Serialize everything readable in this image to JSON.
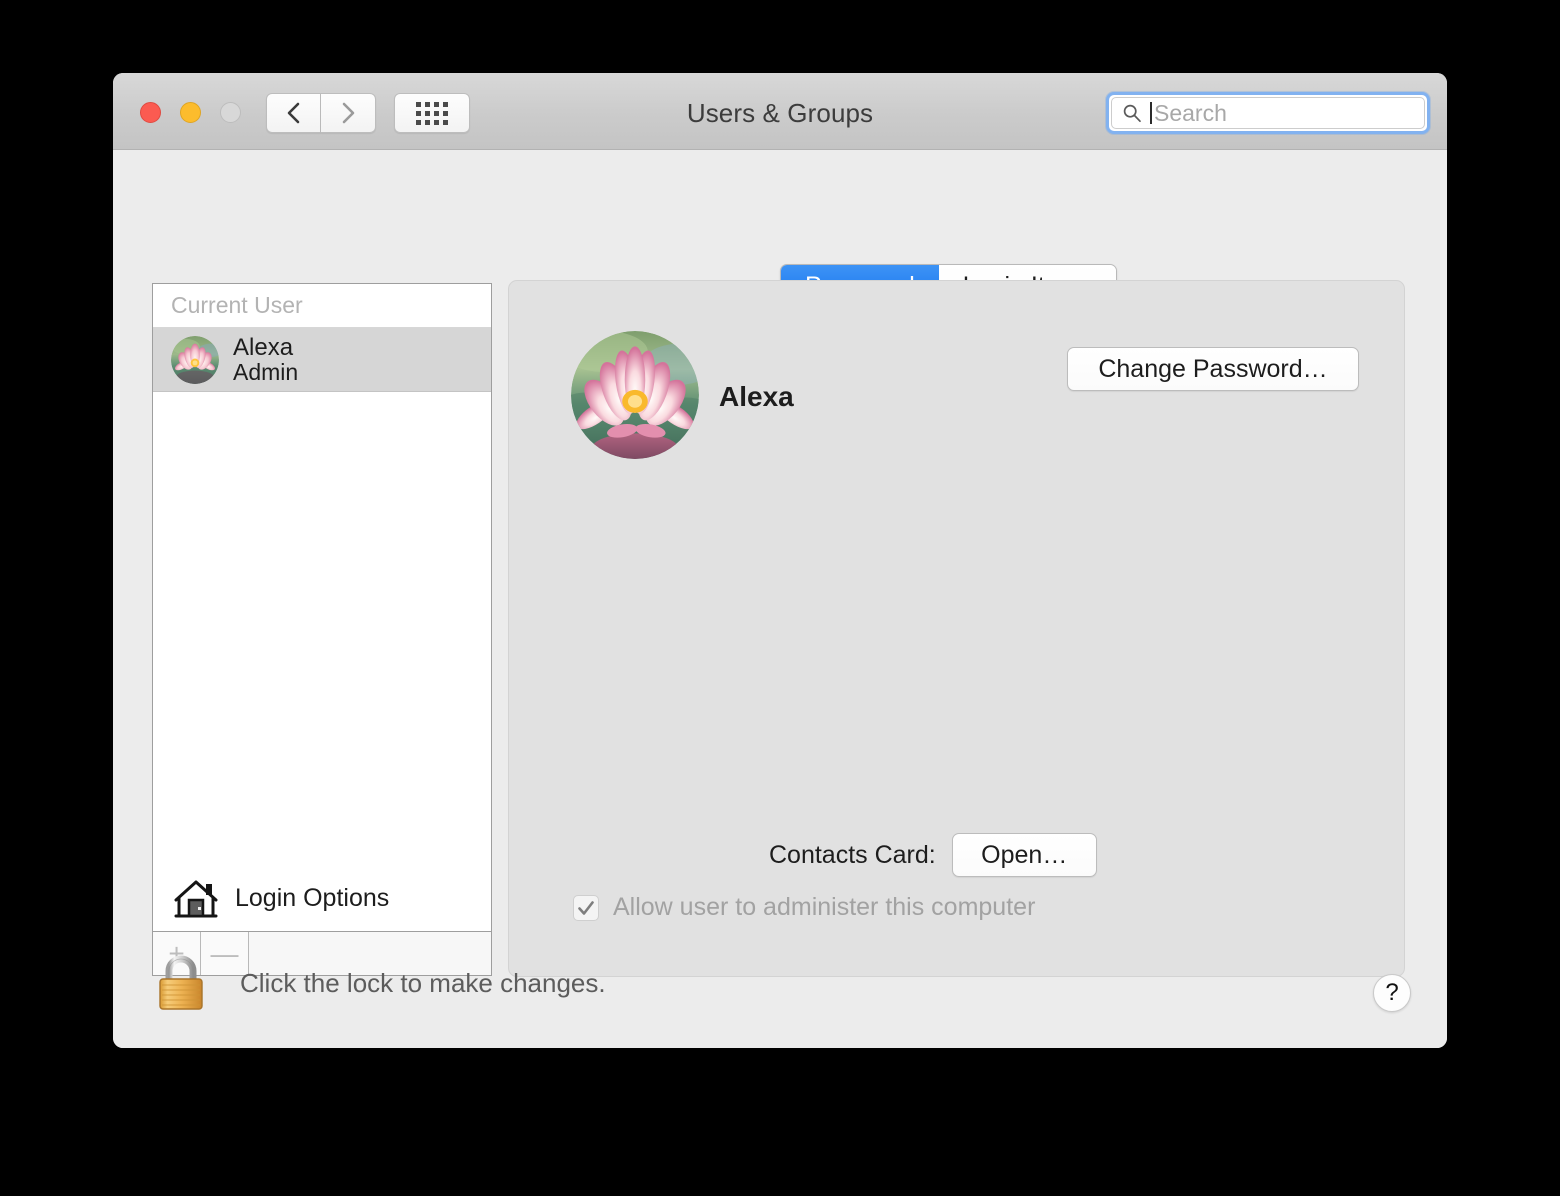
{
  "window": {
    "title": "Users & Groups",
    "controls": {
      "close": "close-button",
      "minimize": "minimize-button",
      "zoom": "zoom-button"
    },
    "nav": {
      "back": "back-icon",
      "forward": "forward-icon",
      "show_all": "grid-icon"
    }
  },
  "search": {
    "placeholder": "Search",
    "value": "",
    "icon": "search-icon",
    "focused": true
  },
  "sidebar": {
    "group_header": "Current User",
    "users": [
      {
        "name": "Alexa",
        "role": "Admin",
        "selected": true,
        "avatar": "water-lily-photo"
      }
    ],
    "login_options": {
      "label": "Login Options",
      "icon": "home-icon"
    },
    "toolbar": {
      "add": "+",
      "remove": "—",
      "add_enabled": false,
      "remove_enabled": false
    }
  },
  "tabs": [
    {
      "label": "Password",
      "active": true
    },
    {
      "label": "Login Items",
      "active": false
    }
  ],
  "panel": {
    "avatar": "water-lily-photo",
    "user_name": "Alexa",
    "change_password_label": "Change Password…",
    "contacts_card_label": "Contacts Card:",
    "open_label": "Open…",
    "admin_checkbox": {
      "label": "Allow user to administer this computer",
      "checked": true,
      "enabled": false
    }
  },
  "footer": {
    "lock_icon": "lock-closed-icon",
    "lock_text": "Click the lock to make changes.",
    "help_label": "?"
  },
  "colors": {
    "accent": "#1472ee",
    "titlebar": "#cbcbcb",
    "window_bg": "#ececec",
    "panel_bg": "#e1e1e1",
    "selection": "#d6d6d6",
    "close": "#fb5b51",
    "minimize": "#fcbc2d",
    "zoom_disabled": "#d8d8d8",
    "search_focus_ring": "#82b2f0"
  }
}
